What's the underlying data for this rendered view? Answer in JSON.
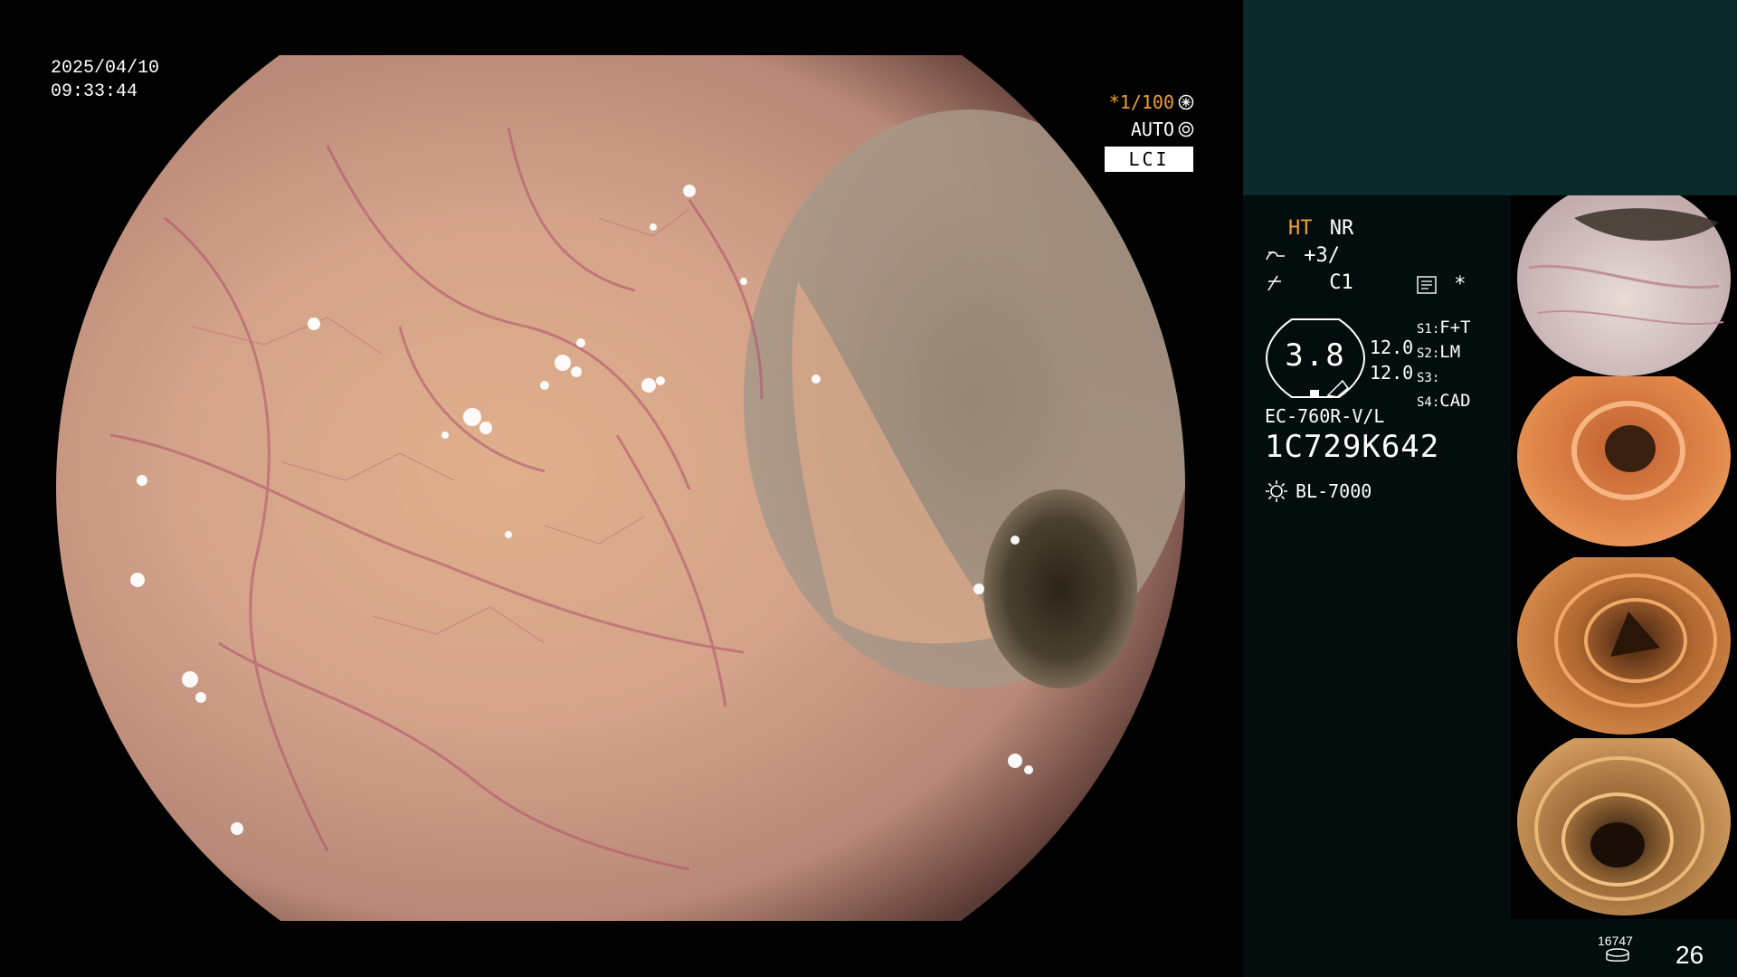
{
  "overlay": {
    "date": "2025/04/10",
    "time": "09:33:44",
    "shutter": "*1/100",
    "mode": "AUTO",
    "light_mode": "LCI"
  },
  "panel": {
    "ht": "HT",
    "nr": "NR",
    "enhance": "+3/",
    "color": "C1",
    "star": "*",
    "gauge_value": "3.8",
    "v1": "12.0",
    "v2": "12.0",
    "s1_label": "S1:",
    "s1_value": "F+T",
    "s2_label": "S2:",
    "s2_value": "LM",
    "s3_label": "S3:",
    "s3_value": "",
    "s4_label": "S4:",
    "s4_value": "CAD",
    "scope_model": "EC-760R-V/L",
    "scope_serial": "1C729K642",
    "light_source": "BL-7000",
    "counter_small": "16747",
    "counter_big": "26"
  },
  "icons": {
    "shutter": "aperture-icon",
    "auto": "iris-icon",
    "enhance": "enhance-curve-icon",
    "color": "color-curve-icon",
    "memo": "memo-icon",
    "light": "sun-icon",
    "disk": "disk-icon"
  },
  "colors": {
    "accent": "#f0a030",
    "panel_top": "#0b2a2a",
    "panel_bg": "#040d0d"
  },
  "thumbnails": [
    {
      "label": "thumbnail-1"
    },
    {
      "label": "thumbnail-2"
    },
    {
      "label": "thumbnail-3"
    },
    {
      "label": "thumbnail-4"
    }
  ]
}
